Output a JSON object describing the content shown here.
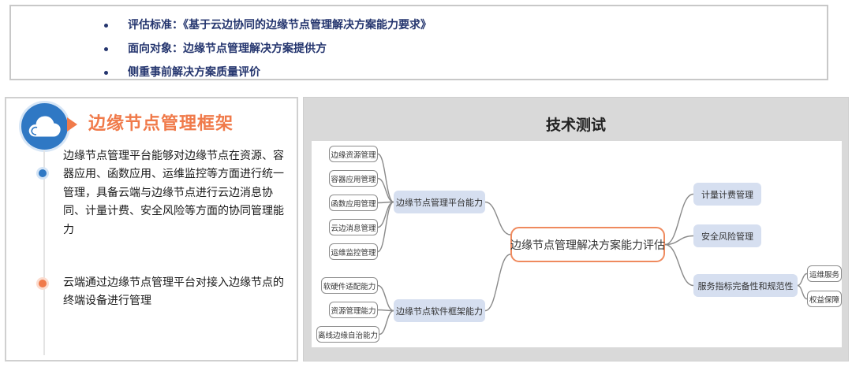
{
  "top": {
    "items": [
      {
        "label": "评估标准：",
        "text": "《基于云边协同的边缘节点管理解决方案能力要求》"
      },
      {
        "label": "面向对象：",
        "text": "边缘节点管理解决方案提供方"
      },
      {
        "label": "侧重事前解决方案质量评价",
        "text": ""
      }
    ]
  },
  "left": {
    "title": "边缘节点管理框架",
    "icon": "cloud-icon",
    "paragraph_1": "边缘节点管理平台能够对边缘节点在资源、容器应用、函数应用、运维监控等方面进行统一管理，具备云端与边缘节点进行云边消息协同、计量计费、安全风险等方面的协同管理能力",
    "paragraph_2": "云端通过边缘节点管理平台对接入边缘节点的终端设备进行管理",
    "colors": {
      "accent": "#f07a4a",
      "blue": "#2f78c4"
    }
  },
  "right": {
    "title": "技术测试",
    "diagram": {
      "central": "边缘节点管理解决方案能力评估",
      "platform": {
        "label": "边缘节点管理平台能力",
        "leaves": [
          "边缘资源管理",
          "容器应用管理",
          "函数应用管理",
          "云边消息管理",
          "运维监控管理"
        ]
      },
      "framework": {
        "label": "边缘节点软件框架能力",
        "leaves": [
          "软硬件适配能力",
          "资源管理能力",
          "离线边缘自治能力"
        ]
      },
      "billing": "计量计费管理",
      "security": "安全风险管理",
      "service": {
        "label": "服务指标完备性和规范性",
        "leaves": [
          "运维服务",
          "权益保障"
        ]
      }
    },
    "colors": {
      "central_border": "#ef8a5e",
      "mid_fill": "#d6dff0",
      "connector": "#8a8a8a"
    }
  }
}
